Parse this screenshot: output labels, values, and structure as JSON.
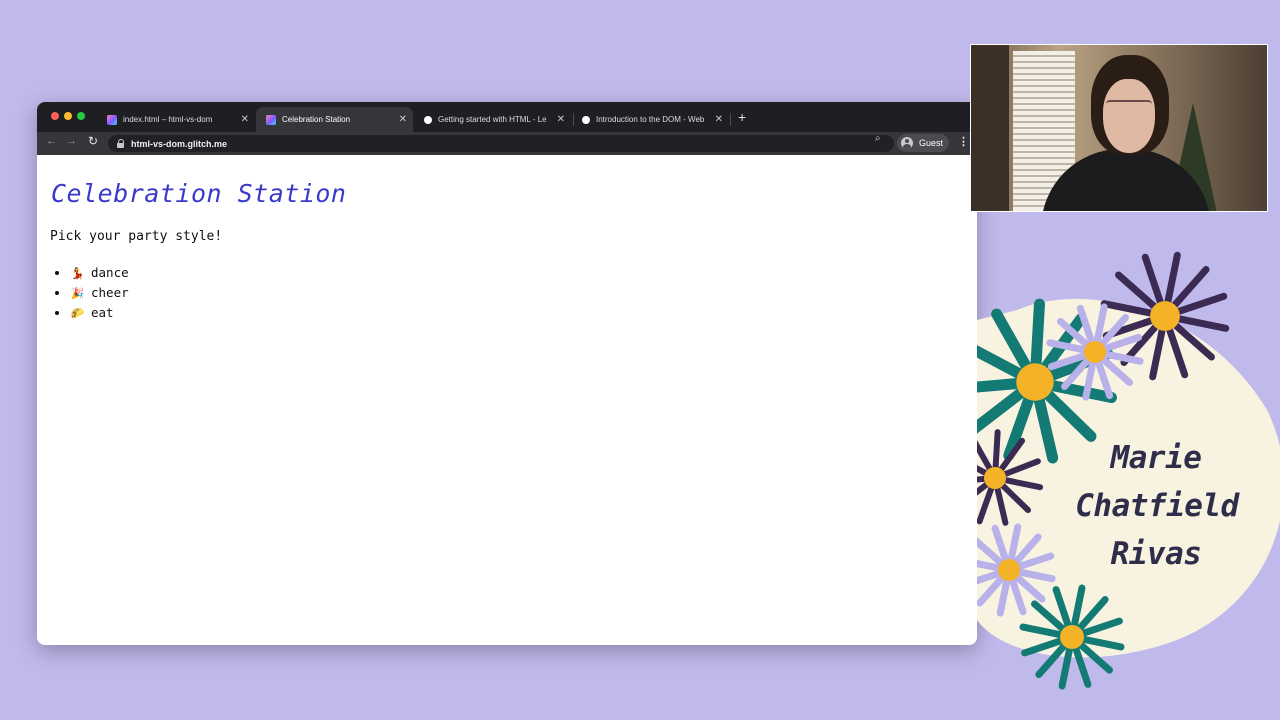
{
  "browser": {
    "tabs": [
      {
        "title": "index.html – html-vs-dom",
        "favicon": "glitch-icon",
        "active": false
      },
      {
        "title": "Celebration Station",
        "favicon": "glitch-icon",
        "active": true
      },
      {
        "title": "Getting started with HTML - Le",
        "favicon": "mdn-icon",
        "active": false
      },
      {
        "title": "Introduction to the DOM - Web",
        "favicon": "mdn-icon",
        "active": false
      }
    ],
    "new_tab": "+",
    "close_glyph": "✕",
    "url": "html-vs-dom.glitch.me",
    "profile_label": "Guest"
  },
  "page": {
    "heading": "Celebration Station",
    "intro": "Pick your party style!",
    "items": [
      {
        "emoji": "💃",
        "label": "dance"
      },
      {
        "emoji": "🎉",
        "label": "cheer"
      },
      {
        "emoji": "🌮",
        "label": "eat"
      }
    ]
  },
  "presenter": {
    "name_lines": [
      "Marie",
      "Chatfield",
      "Rivas"
    ]
  },
  "colors": {
    "background": "#c0b9ec",
    "heading": "#3a39c9",
    "card": "#f8f2e1",
    "teal": "#137a74",
    "plum": "#3b2a52",
    "lavender": "#b8b1ea",
    "center": "#f4b227"
  }
}
